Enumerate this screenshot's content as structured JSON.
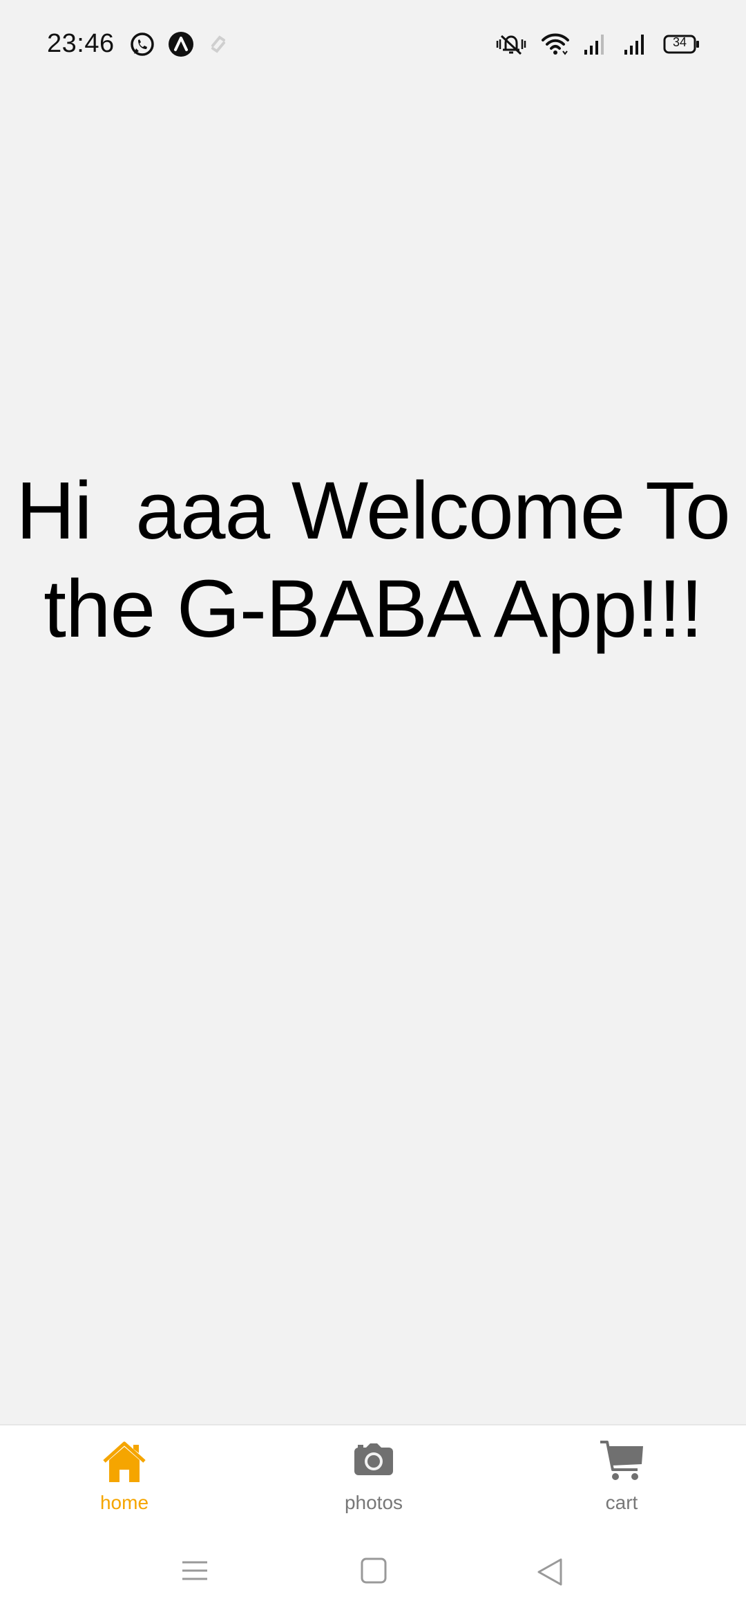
{
  "status_bar": {
    "time": "23:46",
    "battery": "34",
    "left_icons": [
      "whatsapp-icon",
      "arrow-up-circle-icon",
      "link-icon"
    ],
    "right_icons": [
      "vibrate-mute-icon",
      "wifi-icon",
      "signal-icon",
      "signal-icon",
      "battery-icon"
    ]
  },
  "main": {
    "welcome_text": "Hi  aaa Welcome To\nthe G-BABA App!!!"
  },
  "bottom_nav": {
    "tabs": [
      {
        "label": "home",
        "icon": "home-icon",
        "active": true
      },
      {
        "label": "photos",
        "icon": "camera-icon",
        "active": false
      },
      {
        "label": "cart",
        "icon": "cart-icon",
        "active": false
      }
    ],
    "active_color": "#f5a500",
    "inactive_color": "#777777"
  },
  "system_nav": {
    "buttons": [
      "menu-icon",
      "home-square-icon",
      "back-triangle-icon"
    ]
  }
}
